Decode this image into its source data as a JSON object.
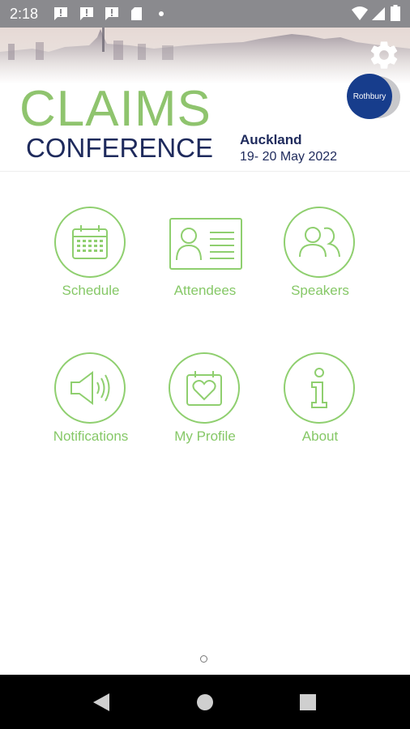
{
  "status_bar": {
    "time": "2:18",
    "icons": [
      "message-alert-icon",
      "message-alert-icon",
      "message-alert-icon",
      "sd-card-icon",
      "dot-icon",
      "wifi-icon",
      "signal-icon",
      "battery-icon"
    ]
  },
  "header": {
    "title_line1": "CLAIMS",
    "title_line2": "CONFERENCE",
    "city": "Auckland",
    "dates": "19- 20 May 2022",
    "sponsor_logo": "Rothbury",
    "settings_icon": "gear-icon"
  },
  "colors": {
    "accent_green": "#86c867",
    "navy": "#1e2a5c",
    "rothbury_blue": "#173d8c"
  },
  "menu": [
    {
      "label": "Schedule",
      "icon": "calendar-icon"
    },
    {
      "label": "Attendees",
      "icon": "id-card-icon"
    },
    {
      "label": "Speakers",
      "icon": "people-icon"
    },
    {
      "label": "Notifications",
      "icon": "speaker-icon"
    },
    {
      "label": "My Profile",
      "icon": "heart-calendar-icon"
    },
    {
      "label": "About",
      "icon": "info-icon"
    }
  ],
  "nav_bar": {
    "buttons": [
      "back-icon",
      "home-icon",
      "recents-icon"
    ]
  }
}
